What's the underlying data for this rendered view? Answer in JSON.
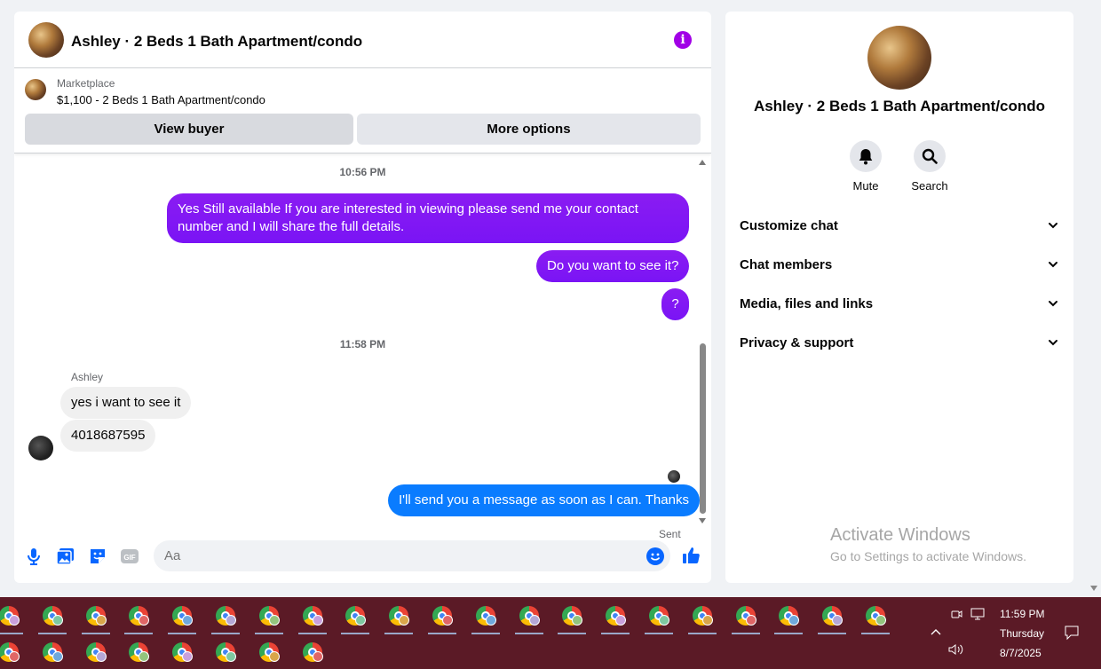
{
  "chat": {
    "title": "Ashley · 2 Beds 1 Bath Apartment/condo",
    "marketplace_label": "Marketplace",
    "listing": "$1,100 - 2 Beds 1 Bath Apartment/condo",
    "view_buyer_label": "View buyer",
    "more_options_label": "More options",
    "messages": [
      {
        "type": "timestamp",
        "text": "10:56 PM"
      },
      {
        "type": "outgoing",
        "text": "Yes Still available If you are interested in viewing please send me your contact number and I will share the full details."
      },
      {
        "type": "outgoing",
        "text": "Do you want to see it?"
      },
      {
        "type": "outgoing",
        "text": "?"
      },
      {
        "type": "timestamp",
        "text": "11:58 PM"
      },
      {
        "type": "sender",
        "text": "Ashley"
      },
      {
        "type": "incoming",
        "text": "yes i want to see it"
      },
      {
        "type": "incoming",
        "text": "4018687595"
      },
      {
        "type": "outgoing",
        "text": "I'll send you a message as soon as I can. Thanks"
      },
      {
        "type": "status",
        "text": "Sent"
      }
    ],
    "input_placeholder": "Aa"
  },
  "details": {
    "title": "Ashley · 2 Beds 1 Bath Apartment/condo",
    "mute_label": "Mute",
    "search_label": "Search",
    "sections": [
      "Customize chat",
      "Chat members",
      "Media, files and links",
      "Privacy & support"
    ]
  },
  "watermark": {
    "line1": "Activate Windows",
    "line2": "Go to Settings to activate Windows."
  },
  "taskbar": {
    "time": "11:59 PM",
    "day": "Thursday",
    "date": "8/7/2025"
  },
  "colors": {
    "outgoing_bubble": "#7a14f5",
    "last_outgoing_bubble": "#0a7cff",
    "accent": "#0866ff",
    "info_button": "#a100e6",
    "taskbar": "#5b1a26"
  }
}
